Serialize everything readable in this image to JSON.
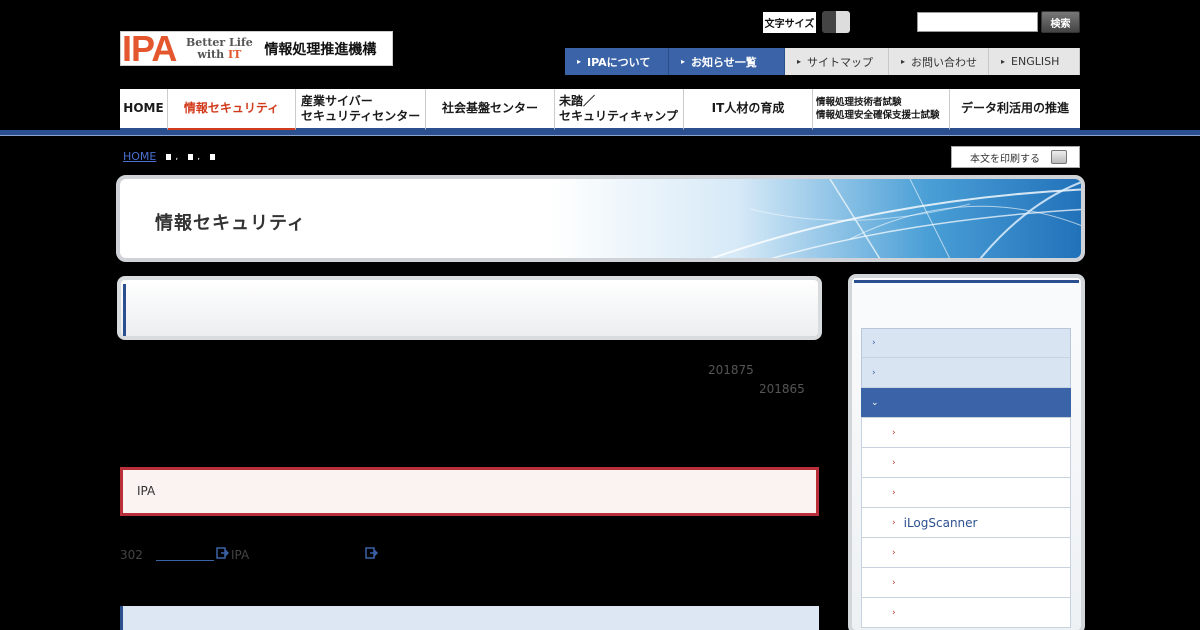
{
  "header": {
    "logo": {
      "ipa": "IPA",
      "tagline_1": "Better Life",
      "tagline_2": "with",
      "tagline_it": "IT",
      "org_name": "情報処理推進機構"
    },
    "font_size_label": "文字サイズ",
    "search": {
      "value": "",
      "button_label": "検索"
    },
    "util_nav": [
      {
        "label": "IPAについて",
        "style": "blue"
      },
      {
        "label": "お知らせ一覧",
        "style": "blue"
      },
      {
        "label": "サイトマップ",
        "style": "gray"
      },
      {
        "label": "お問い合わせ",
        "style": "gray"
      },
      {
        "label": "ENGLISH",
        "style": "gray"
      }
    ]
  },
  "gnav": {
    "items": [
      {
        "line1": "HOME",
        "line2": ""
      },
      {
        "line1": "情報セキュリティ",
        "line2": "",
        "active": true
      },
      {
        "line1": "産業サイバー",
        "line2": "セキュリティセンター"
      },
      {
        "line1": "社会基盤センター",
        "line2": ""
      },
      {
        "line1": "未踏／",
        "line2": "セキュリティキャンプ"
      },
      {
        "line1": "IT人材の育成",
        "line2": ""
      },
      {
        "line1": "情報処理技術者試験",
        "line2": "情報処理安全確保支援士試験"
      },
      {
        "line1": "データ利活用の推進",
        "line2": ""
      }
    ]
  },
  "breadcrumb": {
    "home": "HOME",
    "sep": ","
  },
  "print_label": "本文を印刷する",
  "banner_title": "情報セキュリティ",
  "content": {
    "date_1": "201875",
    "date_2": "201865",
    "notice_text": "IPA",
    "ref_number": "302",
    "ref_ipa": "IPA"
  },
  "side_nav": {
    "items_lvl1": [
      "",
      ""
    ],
    "open_item": "",
    "items_lvl2": [
      "",
      "",
      "",
      "iLogScanner",
      "",
      "",
      ""
    ]
  },
  "colors": {
    "primary": "#2c4f8f",
    "accent": "#d23a1c",
    "notice_border": "#b9303a"
  }
}
